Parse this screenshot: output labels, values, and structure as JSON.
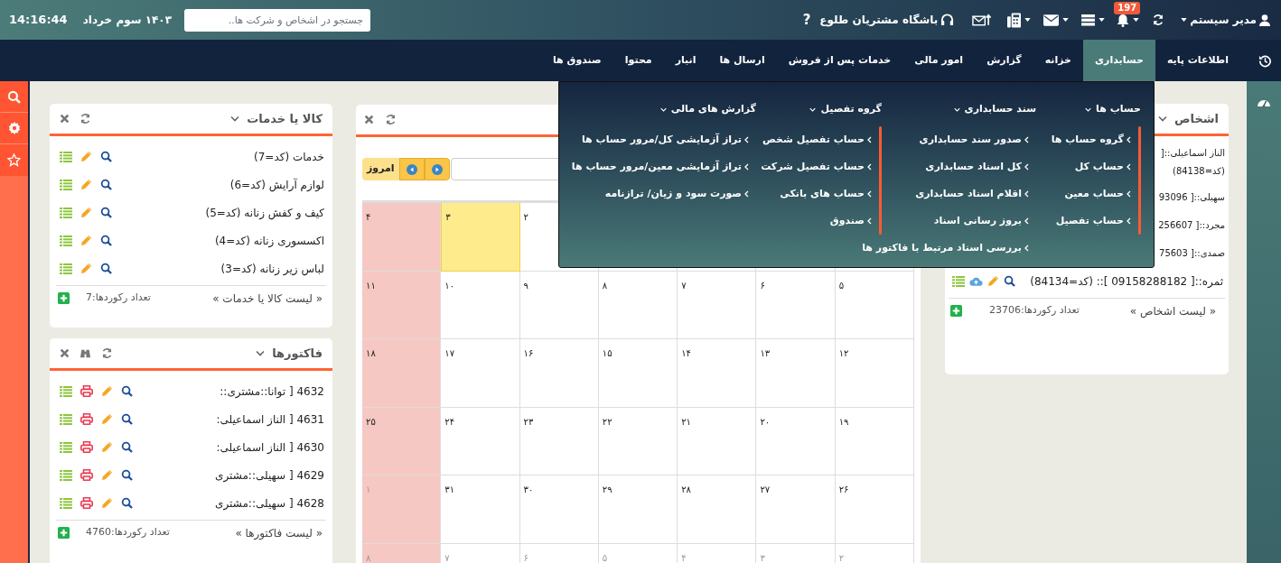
{
  "top_bar": {
    "time": "14:16:44",
    "date": "۱۴۰۳ سوم خرداد",
    "search": {
      "placeholder": "جستجو در اشخاص و شرکت ها.."
    },
    "user": "مدیر سیستم",
    "notification_count": "197",
    "club_link": "باشگاه مشتریان طلوع",
    "help": "?"
  },
  "nav": {
    "tabs": [
      {
        "label": "اطلاعات پایه",
        "selected": false
      },
      {
        "label": "حسابداری",
        "selected": true
      },
      {
        "label": "خزانه",
        "selected": false
      },
      {
        "label": "گزارش",
        "selected": false
      },
      {
        "label": "امور مالی",
        "selected": false
      },
      {
        "label": "خدمات پس از فروش",
        "selected": false
      },
      {
        "label": "ارسال ها",
        "selected": false
      },
      {
        "label": "انبار",
        "selected": false
      },
      {
        "label": "محتوا",
        "selected": false
      },
      {
        "label": "صندوق ها",
        "selected": false
      }
    ]
  },
  "dropdown": {
    "columns": [
      {
        "title": "حساب ها",
        "items": [
          "گروه حساب ها",
          "حساب کل",
          "حساب معین",
          "حساب تفصیل"
        ]
      },
      {
        "title": "سند حسابداری",
        "items": [
          "صدور سند حسابداری",
          "کل اسناد حسابداری",
          "اقلام اسناد حسابداری",
          "بروز رسانی اسناد",
          "بررسی اسناد مرتبط با فاکتور ها"
        ]
      },
      {
        "title": "گروه تفصیل",
        "items": [
          "حساب تفصیل شخص",
          "حساب تفصیل شرکت",
          "حساب های بانکی",
          "صندوق"
        ]
      },
      {
        "title": "گزارش های مالی",
        "items": [
          "تراز آزمایشی کل/مرور حساب ها",
          "تراز آزمایشی معین/مرور حساب ها",
          "صورت سود و زیان/ ترازنامه"
        ]
      }
    ]
  },
  "products_panel": {
    "title": "کالا یا خدمات",
    "items": [
      "خدمات (کد=7)",
      "لوازم آرایش (کد=6)",
      "کیف و کفش زنانه (کد=5)",
      "اکسسوری زنانه (کد=4)",
      "لباس زیر زنانه (کد=3)"
    ],
    "footer_link": "« لیست کالا یا خدمات »",
    "record_count": "تعداد رکوردها:7"
  },
  "invoices_panel": {
    "title": "فاکتورها",
    "items": [
      "4632 [ توانا::مشتری::",
      "4631 [ الناز اسماعیلی:",
      "4630 [ الناز اسماعیلی:",
      "4629 [ سهیلی::مشتری",
      "4628 [ سهیلی::مشتری"
    ],
    "footer_link": "« لیست فاکتورها »",
    "record_count": "تعداد رکوردها:4760"
  },
  "calendar": {
    "today_button": "امروز",
    "weeks": [
      {
        "days": [
          {
            "today": false
          },
          {
            "today": false
          },
          {
            "today": false
          },
          {
            "today": false
          },
          {
            "day": "۲",
            "today": false,
            "other_month": false
          },
          {
            "day": "۳",
            "today": true,
            "other_month": false
          },
          {
            "day": "۴",
            "today": false,
            "other_month": false
          }
        ]
      },
      {
        "days": [
          {
            "day": "۵",
            "today": false,
            "other_month": false
          },
          {
            "day": "۶",
            "today": false,
            "other_month": false
          },
          {
            "day": "۷",
            "today": false,
            "other_month": false
          },
          {
            "day": "۸",
            "today": false,
            "other_month": false
          },
          {
            "day": "۹",
            "today": false,
            "other_month": false
          },
          {
            "day": "۱۰",
            "today": false,
            "other_month": false
          },
          {
            "day": "۱۱",
            "today": false,
            "other_month": false
          }
        ]
      },
      {
        "days": [
          {
            "day": "۱۲",
            "today": false,
            "other_month": false
          },
          {
            "day": "۱۳",
            "today": false,
            "other_month": false
          },
          {
            "day": "۱۴",
            "today": false,
            "other_month": false
          },
          {
            "day": "۱۵",
            "today": false,
            "other_month": false
          },
          {
            "day": "۱۶",
            "today": false,
            "other_month": false
          },
          {
            "day": "۱۷",
            "today": false,
            "other_month": false
          },
          {
            "day": "۱۸",
            "today": false,
            "other_month": false
          }
        ]
      },
      {
        "days": [
          {
            "day": "۱۹",
            "today": false,
            "other_month": false
          },
          {
            "day": "۲۰",
            "today": false,
            "other_month": false
          },
          {
            "day": "۲۱",
            "today": false,
            "other_month": false
          },
          {
            "day": "۲۲",
            "today": false,
            "other_month": false
          },
          {
            "day": "۲۳",
            "today": false,
            "other_month": false
          },
          {
            "day": "۲۴",
            "today": false,
            "other_month": false
          },
          {
            "day": "۲۵",
            "today": false,
            "other_month": false
          }
        ]
      },
      {
        "days": [
          {
            "day": "۲۶",
            "today": false,
            "other_month": false
          },
          {
            "day": "۲۷",
            "today": false,
            "other_month": false
          },
          {
            "day": "۲۸",
            "today": false,
            "other_month": false
          },
          {
            "day": "۲۹",
            "today": false,
            "other_month": false
          },
          {
            "day": "۳۰",
            "today": false,
            "other_month": false
          },
          {
            "day": "۳۱",
            "today": false,
            "other_month": false
          },
          {
            "day": "۱",
            "today": false,
            "other_month": true
          }
        ]
      },
      {
        "days": [
          {
            "day": "۲",
            "today": false,
            "other_month": true
          },
          {
            "day": "۳",
            "today": false,
            "other_month": true
          },
          {
            "day": "۴",
            "today": false,
            "other_month": true
          },
          {
            "day": "۵",
            "today": false,
            "other_month": true
          },
          {
            "day": "۶",
            "today": false,
            "other_month": true
          },
          {
            "day": "۷",
            "today": false,
            "other_month": true
          },
          {
            "day": "۸",
            "today": false,
            "other_month": true
          }
        ]
      }
    ]
  },
  "persons_panel": {
    "title": "اشخاص",
    "items": [
      {
        "kind": "clipped",
        "text": "الناز اسماعیلی::[ (کد=84138)"
      },
      {
        "kind": "clipped",
        "text": "سهیلی::[ 93096"
      },
      {
        "kind": "clipped",
        "text": "مجرد::[ 256607"
      },
      {
        "kind": "clipped",
        "text": "صمدی::[ 75603"
      },
      {
        "kind": "full",
        "text": "ثمره::[ 09158288182 ]:: (کد=84134)"
      }
    ],
    "footer_link": "« لیست اشخاص »",
    "record_count": "تعداد رکوردها:23706"
  }
}
